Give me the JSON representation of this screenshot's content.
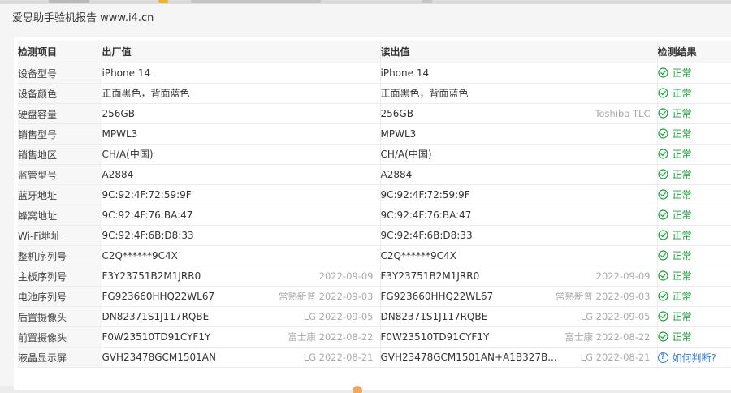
{
  "window": {
    "title": "爱思助手验机报告 www.i4.cn"
  },
  "table": {
    "headers": {
      "item": "检测项目",
      "factory": "出厂值",
      "read": "读出值",
      "result": "检测结果"
    },
    "rows": [
      {
        "item": "设备型号",
        "factory": "iPhone 14",
        "factory_note": "",
        "read": "iPhone 14",
        "read_note": "",
        "result": "正常"
      },
      {
        "item": "设备颜色",
        "factory": "正面黑色，背面蓝色",
        "factory_note": "",
        "read": "正面黑色，背面蓝色",
        "read_note": "",
        "result": "正常"
      },
      {
        "item": "硬盘容量",
        "factory": "256GB",
        "factory_note": "",
        "read": "256GB",
        "read_note": "Toshiba TLC",
        "result": "正常"
      },
      {
        "item": "销售型号",
        "factory": "MPWL3",
        "factory_note": "",
        "read": "MPWL3",
        "read_note": "",
        "result": "正常"
      },
      {
        "item": "销售地区",
        "factory": "CH/A(中国)",
        "factory_note": "",
        "read": "CH/A(中国)",
        "read_note": "",
        "result": "正常"
      },
      {
        "item": "监管型号",
        "factory": "A2884",
        "factory_note": "",
        "read": "A2884",
        "read_note": "",
        "result": "正常"
      },
      {
        "item": "蓝牙地址",
        "factory": "9C:92:4F:72:59:9F",
        "factory_note": "",
        "read": "9C:92:4F:72:59:9F",
        "read_note": "",
        "result": "正常"
      },
      {
        "item": "蜂窝地址",
        "factory": "9C:92:4F:76:BA:47",
        "factory_note": "",
        "read": "9C:92:4F:76:BA:47",
        "read_note": "",
        "result": "正常"
      },
      {
        "item": "Wi-Fi地址",
        "factory": "9C:92:4F:6B:D8:33",
        "factory_note": "",
        "read": "9C:92:4F:6B:D8:33",
        "read_note": "",
        "result": "正常"
      },
      {
        "item": "整机序列号",
        "factory": "C2Q******9C4X",
        "factory_note": "",
        "read": "C2Q******9C4X",
        "read_note": "",
        "result": "正常"
      },
      {
        "item": "主板序列号",
        "factory": "F3Y23751B2M1JRR0",
        "factory_note": "2022-09-09",
        "read": "F3Y23751B2M1JRR0",
        "read_note": "2022-09-09",
        "result": "正常"
      },
      {
        "item": "电池序列号",
        "factory": "FG923660HHQ22WL67",
        "factory_note": "常熟新普 2022-09-03",
        "read": "FG923660HHQ22WL67",
        "read_note": "常熟新普 2022-09-03",
        "result": "正常"
      },
      {
        "item": "后置摄像头",
        "factory": "DN82371S1J117RQBE",
        "factory_note": "LG 2022-09-05",
        "read": "DN82371S1J117RQBE",
        "read_note": "LG 2022-09-05",
        "result": "正常"
      },
      {
        "item": "前置摄像头",
        "factory": "F0W23510TD91CYF1Y",
        "factory_note": "富士康 2022-08-22",
        "read": "F0W23510TD91CYF1Y",
        "read_note": "富士康 2022-08-22",
        "result": "正常"
      },
      {
        "item": "液晶显示屏",
        "factory": "GVH23478GCM1501AN",
        "factory_note": "LG 2022-08-21",
        "read": "GVH23478GCM1501AN+A1B327B...",
        "read_note": "LG 2022-08-21",
        "result": "如何判断?",
        "result_type": "link"
      }
    ]
  },
  "colors": {
    "ok": "#19a23a",
    "link": "#2f7ce0"
  }
}
